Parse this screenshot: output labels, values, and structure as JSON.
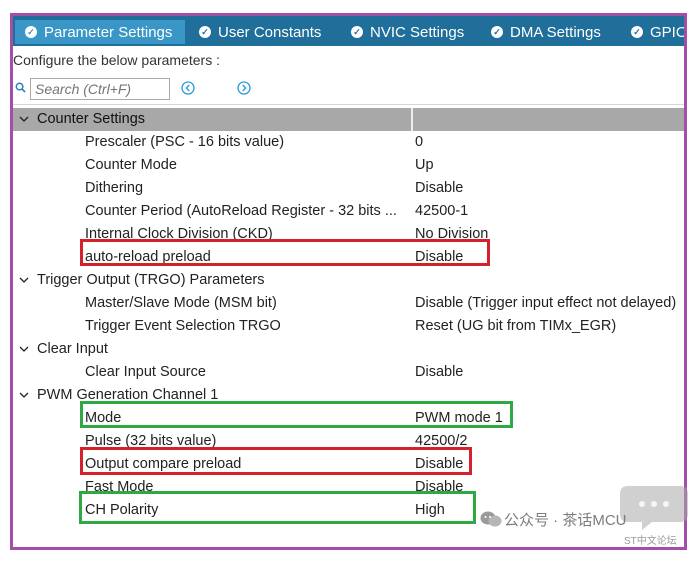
{
  "tabs": [
    {
      "label": "Parameter Settings",
      "active": true
    },
    {
      "label": "User Constants",
      "active": false
    },
    {
      "label": "NVIC Settings",
      "active": false
    },
    {
      "label": "DMA Settings",
      "active": false
    },
    {
      "label": "GPIO",
      "active": false
    }
  ],
  "hint": "Configure the below parameters :",
  "search": {
    "placeholder": "Search (Ctrl+F)"
  },
  "groups": {
    "counter": "Counter Settings",
    "trgo": "Trigger Output (TRGO) Parameters",
    "clear": "Clear Input",
    "pwm": "PWM Generation Channel 1"
  },
  "params": {
    "prescaler": {
      "name": "Prescaler (PSC - 16 bits value)",
      "value": "0"
    },
    "counter_mode": {
      "name": "Counter Mode",
      "value": "Up"
    },
    "dithering": {
      "name": "Dithering",
      "value": "Disable"
    },
    "counter_period": {
      "name": "Counter Period (AutoReload Register - 32 bits ...",
      "value": "42500-1"
    },
    "ckd": {
      "name": "Internal Clock Division (CKD)",
      "value": "No Division"
    },
    "auto_reload": {
      "name": "auto-reload preload",
      "value": "Disable"
    },
    "msm": {
      "name": "Master/Slave Mode (MSM bit)",
      "value": "Disable (Trigger input effect not delayed)"
    },
    "trgo_sel": {
      "name": "Trigger Event Selection TRGO",
      "value": "Reset (UG bit from TIMx_EGR)"
    },
    "clear_src": {
      "name": "Clear Input Source",
      "value": "Disable"
    },
    "mode": {
      "name": "Mode",
      "value": "PWM mode 1"
    },
    "pulse": {
      "name": "Pulse (32 bits value)",
      "value": "42500/2"
    },
    "oc_preload": {
      "name": "Output compare preload",
      "value": "Disable"
    },
    "fast_mode": {
      "name": "Fast Mode",
      "value": "Disable"
    },
    "polarity": {
      "name": "CH Polarity",
      "value": "High"
    }
  },
  "watermark": {
    "text": "公众号 · 茶话MCU",
    "sub": "ST中文论坛"
  },
  "colors": {
    "tab_bar": "#1f6f9a",
    "tab_active": "#3a96c6",
    "frame": "#a44ea7",
    "highlight_red": "#d3222b",
    "highlight_green": "#2ea944"
  }
}
